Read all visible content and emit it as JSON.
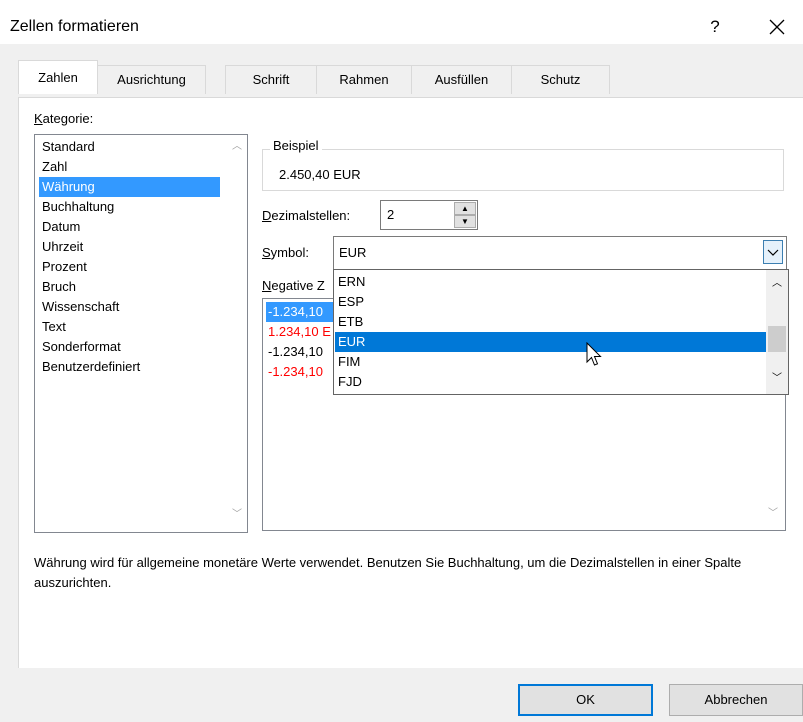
{
  "window": {
    "title": "Zellen formatieren",
    "help_label": "?",
    "close_icon": "close-icon"
  },
  "tabs": [
    {
      "label": "Zahlen",
      "active": true
    },
    {
      "label": "Ausrichtung",
      "active": false
    },
    {
      "label": "Schrift",
      "active": false
    },
    {
      "label": "Rahmen",
      "active": false
    },
    {
      "label": "Ausfüllen",
      "active": false
    },
    {
      "label": "Schutz",
      "active": false
    }
  ],
  "kategorie": {
    "label": "Kategorie:",
    "items": [
      "Standard",
      "Zahl",
      "Währung",
      "Buchhaltung",
      "Datum",
      "Uhrzeit",
      "Prozent",
      "Bruch",
      "Wissenschaft",
      "Text",
      "Sonderformat",
      "Benutzerdefiniert"
    ],
    "selected": "Währung"
  },
  "beispiel": {
    "label": "Beispiel",
    "value": "2.450,40 EUR"
  },
  "dezimalstellen": {
    "label": "Dezimalstellen:",
    "value": "2"
  },
  "symbol": {
    "label": "Symbol:",
    "value": "EUR",
    "dropdown_items": [
      "ERN",
      "ESP",
      "ETB",
      "EUR",
      "FIM",
      "FJD"
    ],
    "selected": "EUR"
  },
  "negative": {
    "label": "Negative Z",
    "items": [
      {
        "text": "-1.234,10",
        "color": "#ffffff",
        "selected": true
      },
      {
        "text": "1.234,10 E",
        "color": "#ff0000",
        "selected": false
      },
      {
        "text": "-1.234,10",
        "color": "#000000",
        "selected": false
      },
      {
        "text": "-1.234,10",
        "color": "#ff0000",
        "selected": false
      }
    ]
  },
  "description": "Währung wird für allgemeine monetäre Werte verwendet. Benutzen Sie Buchhaltung, um die Dezimalstellen in einer Spalte auszurichten.",
  "buttons": {
    "ok": "OK",
    "cancel": "Abbrechen"
  },
  "colors": {
    "selection": "#3399ff",
    "dropdown_selection": "#0078d7",
    "negative_red": "#ff0000"
  }
}
